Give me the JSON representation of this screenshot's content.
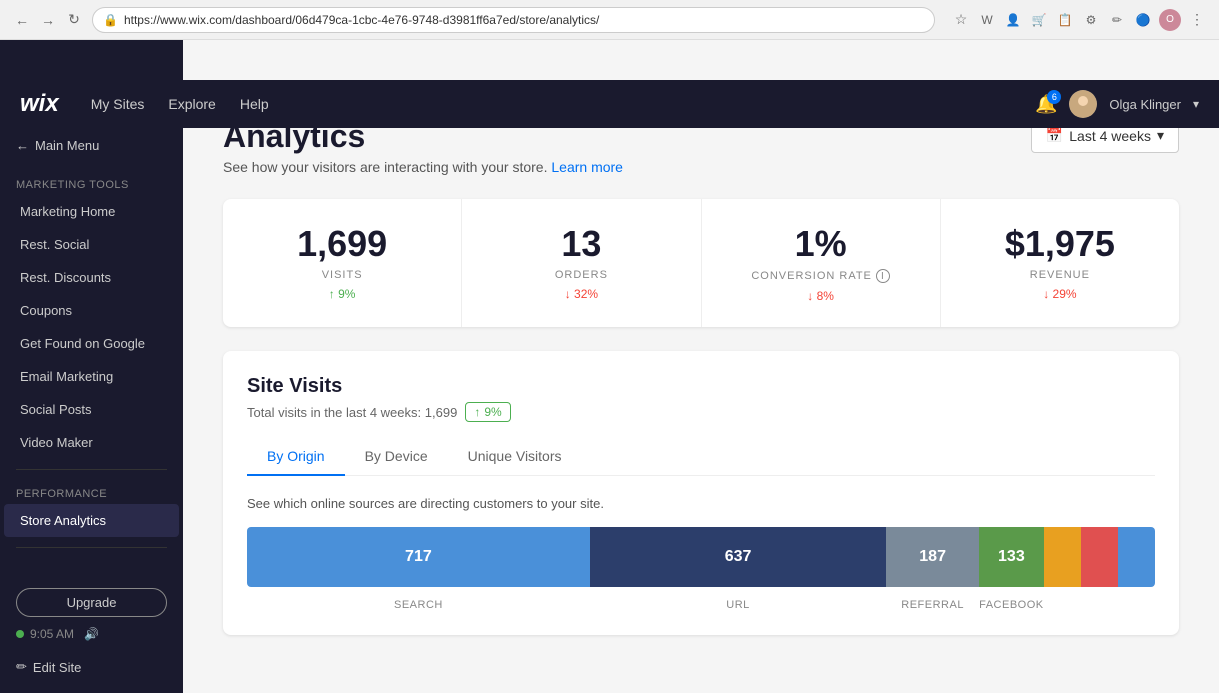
{
  "browser": {
    "url": "https://www.wix.com/dashboard/06d479ca-1cbc-4e76-9748-d3981ff6a7ed/store/analytics/",
    "back_label": "←",
    "forward_label": "→",
    "refresh_label": "↻"
  },
  "topnav": {
    "logo": "wix",
    "links": [
      "My Sites",
      "Explore",
      "Help"
    ],
    "notif_count": "6",
    "user_name": "Olga Klinger"
  },
  "sidebar": {
    "back_label": "Main Menu",
    "marketing_section": "Marketing Tools",
    "marketing_items": [
      "Marketing Home",
      "Rest. Social",
      "Rest. Discounts",
      "Coupons",
      "Get Found on Google",
      "Email Marketing",
      "Social Posts",
      "Video Maker"
    ],
    "performance_section": "Performance",
    "performance_items": [
      "Store Analytics"
    ],
    "upgrade_label": "Upgrade",
    "time": "9:05 AM",
    "edit_site_label": "Edit Site"
  },
  "page": {
    "title": "Analytics",
    "subtitle": "See how your visitors are interacting with your store.",
    "learn_more": "Learn more",
    "date_filter": "Last 4 weeks",
    "calendar_icon": "📅"
  },
  "stats": [
    {
      "value": "1,699",
      "label": "VISITS",
      "change": "↑ 9%",
      "change_type": "up"
    },
    {
      "value": "13",
      "label": "ORDERS",
      "change": "↓ 32%",
      "change_type": "down"
    },
    {
      "value": "1%",
      "label": "CONVERSION RATE",
      "change": "↓ 8%",
      "change_type": "down",
      "has_info": true
    },
    {
      "value": "$1,975",
      "label": "REVENUE",
      "change": "↓ 29%",
      "change_type": "down"
    }
  ],
  "site_visits": {
    "title": "Site Visits",
    "subtitle_prefix": "Total visits in the last 4 weeks:",
    "total": "1,699",
    "badge": "↑ 9%",
    "tabs": [
      "By Origin",
      "By Device",
      "Unique Visitors"
    ],
    "active_tab": 0,
    "chart_subtitle": "See which online sources are directing customers to your site.",
    "bars": [
      {
        "label": "SEARCH",
        "value": 717,
        "color": "#4a90d9",
        "flex": 37
      },
      {
        "label": "URL",
        "value": 637,
        "color": "#2c3e6b",
        "flex": 32
      },
      {
        "label": "REFERRAL",
        "value": 187,
        "color": "#7a8a9a",
        "flex": 10
      },
      {
        "label": "FACEBOOK",
        "value": 133,
        "color": "#5a9a4a",
        "flex": 7
      },
      {
        "label": "",
        "value": null,
        "color": "#e8a020",
        "flex": 4
      },
      {
        "label": "",
        "value": null,
        "color": "#e05050",
        "flex": 4
      },
      {
        "label": "",
        "value": null,
        "color": "#4a90d9",
        "flex": 4
      }
    ]
  }
}
